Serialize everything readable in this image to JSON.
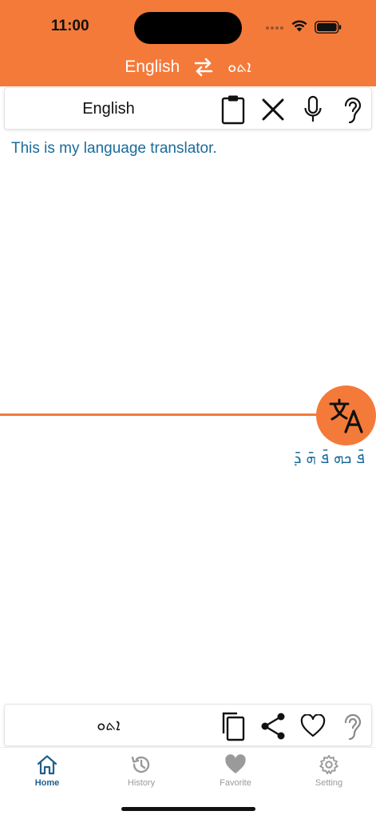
{
  "status_bar": {
    "time": "11:00"
  },
  "header": {
    "source_language": "English",
    "target_language": "ܐܬܘ"
  },
  "source_panel": {
    "language_label": "English",
    "text": "This is my language translator."
  },
  "target_panel": {
    "language_label": "ܐܬܘ",
    "text": "ܦ̄ ܟܗ ܦ̄ ܗ̄ ܕ̄"
  },
  "tabs": [
    {
      "label": "Home",
      "icon": "home-icon",
      "active": true
    },
    {
      "label": "History",
      "icon": "history-icon",
      "active": false
    },
    {
      "label": "Favorite",
      "icon": "heart-icon",
      "active": false
    },
    {
      "label": "Setting",
      "icon": "gear-icon",
      "active": false
    }
  ],
  "colors": {
    "accent": "#F47A3A",
    "text_blue": "#1a6b9a",
    "tab_active": "#1f5f8b",
    "tab_inactive": "#9a9a9a"
  }
}
